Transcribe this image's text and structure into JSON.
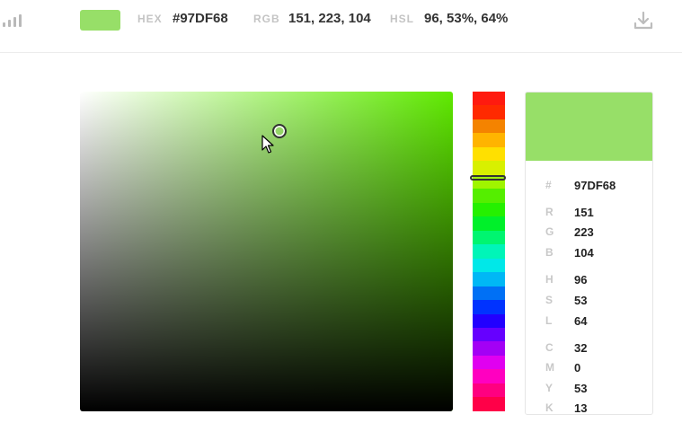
{
  "header": {
    "hex_label": "HEX",
    "hex_value": "#97DF68",
    "rgb_label": "RGB",
    "rgb_value": "151, 223, 104",
    "hsl_label": "HSL",
    "hsl_value": "96, 53%, 64%"
  },
  "colors": {
    "current": "#97DF68",
    "hue_color": "#5FEA00"
  },
  "hue": {
    "bands": [
      "#FF1A0F",
      "#FF2A00",
      "#F48300",
      "#FFB400",
      "#FFE000",
      "#D8F000",
      "#9FF500",
      "#55EE00",
      "#25F000",
      "#00F02A",
      "#00F570",
      "#00F5B8",
      "#00E8E8",
      "#00B8F5",
      "#0070F5",
      "#0033FF",
      "#2200FF",
      "#6600FF",
      "#A300F5",
      "#E000F0",
      "#FF00C0",
      "#FF0080",
      "#FF0048"
    ],
    "selected_position": 0.27
  },
  "details": {
    "hash_label": "#",
    "hash_value": "97DF68",
    "rgb": [
      {
        "label": "R",
        "value": "151"
      },
      {
        "label": "G",
        "value": "223"
      },
      {
        "label": "B",
        "value": "104"
      }
    ],
    "hsl": [
      {
        "label": "H",
        "value": "96"
      },
      {
        "label": "S",
        "value": "53"
      },
      {
        "label": "L",
        "value": "64"
      }
    ],
    "cmyk": [
      {
        "label": "C",
        "value": "32"
      },
      {
        "label": "M",
        "value": "0"
      },
      {
        "label": "Y",
        "value": "53"
      },
      {
        "label": "K",
        "value": "13"
      }
    ]
  },
  "icons": {
    "top_left": "signal-bars-icon",
    "top_right": "download-icon",
    "cursor": "mouse-pointer-icon"
  }
}
